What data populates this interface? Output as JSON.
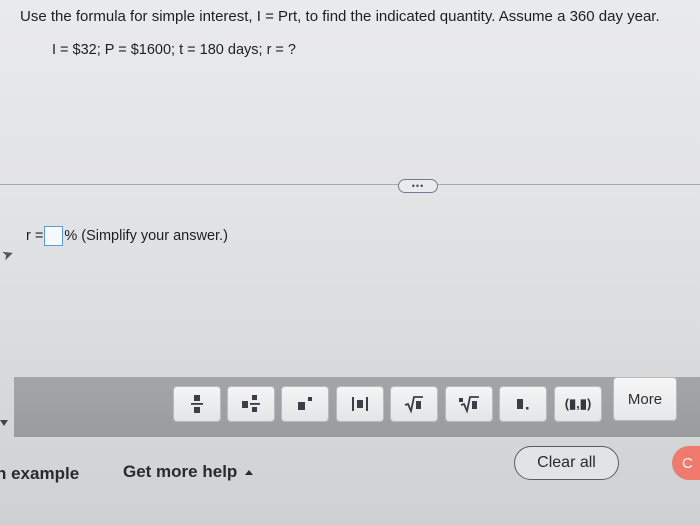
{
  "question": {
    "prompt": "Use the formula for simple interest, I = Prt, to find the indicated quantity. Assume a 360 day year.",
    "given": "I = $32; P = $1600; t = 180 days; r = ?"
  },
  "expand_button": {
    "label": "•••"
  },
  "answer": {
    "prefix": "r =",
    "value": "",
    "suffix": "% (Simplify your answer.)"
  },
  "toolbar": {
    "buttons": [
      {
        "name": "fraction",
        "icon": "fraction-icon"
      },
      {
        "name": "mixed-number",
        "icon": "mixed-number-icon"
      },
      {
        "name": "exponent",
        "icon": "exponent-icon"
      },
      {
        "name": "absolute-value",
        "icon": "absolute-value-icon"
      },
      {
        "name": "square-root",
        "icon": "square-root-icon"
      },
      {
        "name": "nth-root",
        "icon": "nth-root-icon"
      },
      {
        "name": "decimal",
        "icon": "decimal-icon"
      },
      {
        "name": "ordered-pair",
        "icon": "ordered-pair-icon",
        "label": "(▮,▮)"
      }
    ],
    "more_label": "More"
  },
  "footer": {
    "example_label": "n example",
    "help_label": "Get more help",
    "clear_label": "Clear all",
    "check_label": "C"
  },
  "colors": {
    "input_border": "#5b9bd5",
    "toolbar_bg": "#9b9c9e",
    "check_button": "#f07a6c"
  }
}
